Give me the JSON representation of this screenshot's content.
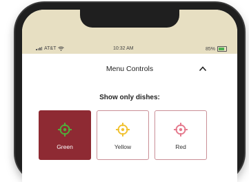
{
  "status_bar": {
    "carrier": "AT&T",
    "time": "10:32 AM",
    "battery": "85%",
    "icons": [
      "signal-icon",
      "wifi-icon",
      "battery-icon"
    ]
  },
  "menu_controls": {
    "title": "Menu Controls",
    "collapse_icon": "chevron-up-icon",
    "subtitle": "Show only dishes:"
  },
  "filters": [
    {
      "label": "Green",
      "icon": "crosshair-icon",
      "color": "#4fae3a",
      "selected": true
    },
    {
      "label": "Yellow",
      "icon": "crosshair-icon",
      "color": "#f1c232",
      "selected": false
    },
    {
      "label": "Red",
      "icon": "crosshair-icon",
      "color": "#e57b8e",
      "selected": false
    }
  ],
  "colors": {
    "accent": "#8e2a33",
    "status_bar_bg": "#e7dfc2"
  }
}
